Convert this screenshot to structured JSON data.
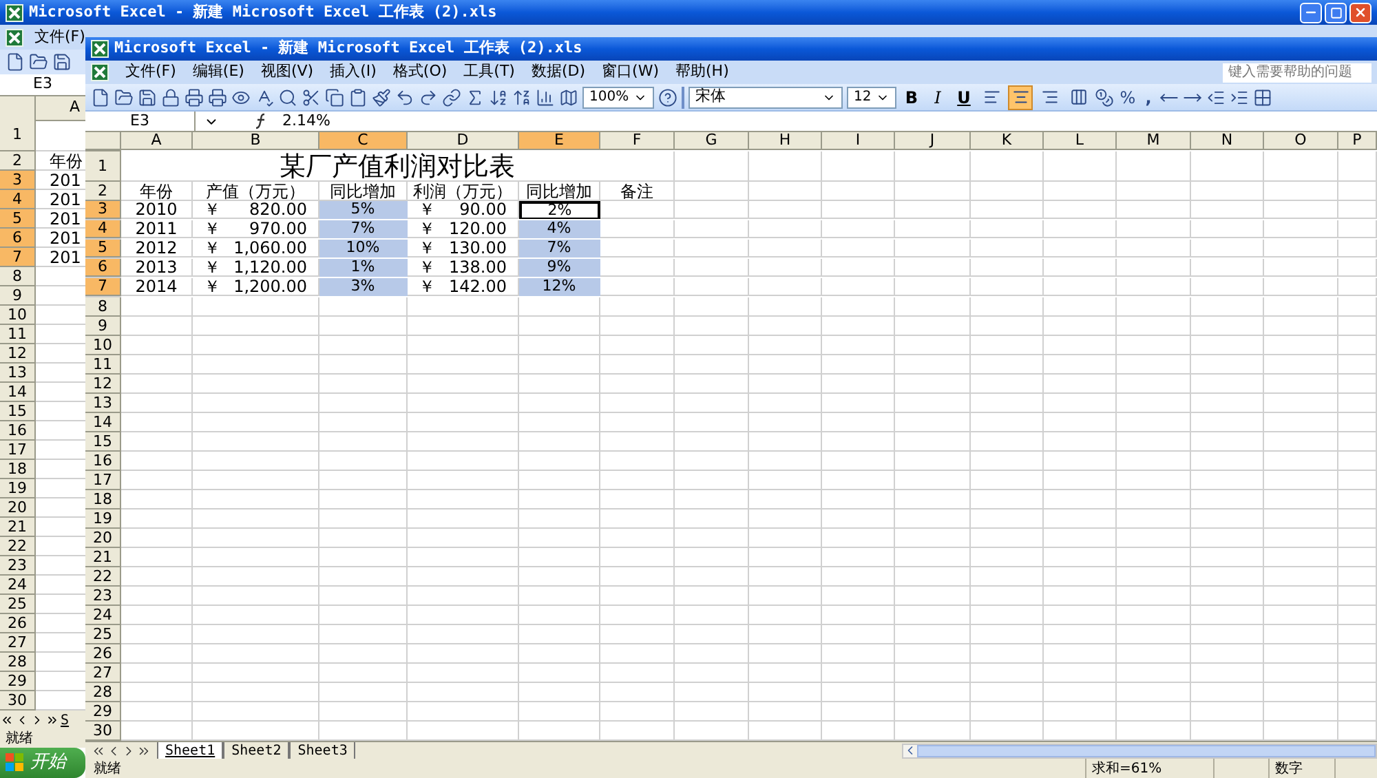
{
  "back_window": {
    "title": "Microsoft Excel - 新建 Microsoft Excel 工作表 (2).xls",
    "menu": [
      "文件(F)"
    ],
    "name_box": "E3",
    "column": {
      "label": "A",
      "selected": false
    },
    "rows": [
      {
        "label": "1",
        "selected": false
      },
      {
        "label": "2",
        "selected": false,
        "value": "年份"
      },
      {
        "label": "3",
        "selected": true,
        "value": "201"
      },
      {
        "label": "4",
        "selected": true,
        "value": "201"
      },
      {
        "label": "5",
        "selected": true,
        "value": "201"
      },
      {
        "label": "6",
        "selected": true,
        "value": "201"
      },
      {
        "label": "7",
        "selected": true,
        "value": "201"
      },
      {
        "label": "8",
        "selected": false
      },
      {
        "label": "9",
        "selected": false
      },
      {
        "label": "10",
        "selected": false
      },
      {
        "label": "11",
        "selected": false
      },
      {
        "label": "12",
        "selected": false
      },
      {
        "label": "13",
        "selected": false
      },
      {
        "label": "14",
        "selected": false
      },
      {
        "label": "15",
        "selected": false
      },
      {
        "label": "16",
        "selected": false
      },
      {
        "label": "17",
        "selected": false
      },
      {
        "label": "18",
        "selected": false
      },
      {
        "label": "19",
        "selected": false
      },
      {
        "label": "20",
        "selected": false
      },
      {
        "label": "21",
        "selected": false
      },
      {
        "label": "22",
        "selected": false
      },
      {
        "label": "23",
        "selected": false
      },
      {
        "label": "24",
        "selected": false
      },
      {
        "label": "25",
        "selected": false
      },
      {
        "label": "26",
        "selected": false
      },
      {
        "label": "27",
        "selected": false
      },
      {
        "label": "28",
        "selected": false
      },
      {
        "label": "29",
        "selected": false
      },
      {
        "label": "30",
        "selected": false
      }
    ],
    "sheet_tab": "S",
    "status": "就绪"
  },
  "taskbar": {
    "start": "开始"
  },
  "front_window": {
    "title": "Microsoft Excel - 新建 Microsoft Excel 工作表 (2).xls",
    "menu": [
      "文件(F)",
      "编辑(E)",
      "视图(V)",
      "插入(I)",
      "格式(O)",
      "工具(T)",
      "数据(D)",
      "窗口(W)",
      "帮助(H)"
    ],
    "help_box": {
      "placeholder": "键入需要帮助的问题"
    },
    "toolbar": {
      "zoom": "100%",
      "font": "宋体",
      "font_size": "12",
      "bold": "B",
      "italic": "I",
      "underline": "U",
      "alignment": [
        {
          "kind": "left",
          "selected": false
        },
        {
          "kind": "center",
          "selected": true
        },
        {
          "kind": "right",
          "selected": false
        },
        {
          "kind": "merge",
          "selected": false
        }
      ],
      "percent": "%",
      "comma": ","
    },
    "formula_bar": {
      "name_box": "E3",
      "value": "2.14%"
    },
    "columns": [
      {
        "label": "A",
        "selected": false
      },
      {
        "label": "B",
        "selected": false
      },
      {
        "label": "C",
        "selected": true
      },
      {
        "label": "D",
        "selected": false
      },
      {
        "label": "E",
        "selected": true
      },
      {
        "label": "F",
        "selected": false
      },
      {
        "label": "G",
        "selected": false
      },
      {
        "label": "H",
        "selected": false
      },
      {
        "label": "I",
        "selected": false
      },
      {
        "label": "J",
        "selected": false
      },
      {
        "label": "K",
        "selected": false
      },
      {
        "label": "L",
        "selected": false
      },
      {
        "label": "M",
        "selected": false
      },
      {
        "label": "N",
        "selected": false
      },
      {
        "label": "O",
        "selected": false
      },
      {
        "label": "P",
        "selected": false
      }
    ],
    "row_headers": [
      {
        "label": "1",
        "selected": false
      },
      {
        "label": "2",
        "selected": false
      },
      {
        "label": "3",
        "selected": true
      },
      {
        "label": "4",
        "selected": true
      },
      {
        "label": "5",
        "selected": true
      },
      {
        "label": "6",
        "selected": true
      },
      {
        "label": "7",
        "selected": true
      },
      {
        "label": "8",
        "selected": false
      },
      {
        "label": "9",
        "selected": false
      },
      {
        "label": "10",
        "selected": false
      },
      {
        "label": "11",
        "selected": false
      },
      {
        "label": "12",
        "selected": false
      },
      {
        "label": "13",
        "selected": false
      },
      {
        "label": "14",
        "selected": false
      },
      {
        "label": "15",
        "selected": false
      },
      {
        "label": "16",
        "selected": false
      },
      {
        "label": "17",
        "selected": false
      },
      {
        "label": "18",
        "selected": false
      },
      {
        "label": "19",
        "selected": false
      },
      {
        "label": "20",
        "selected": false
      },
      {
        "label": "21",
        "selected": false
      },
      {
        "label": "22",
        "selected": false
      },
      {
        "label": "23",
        "selected": false
      },
      {
        "label": "24",
        "selected": false
      },
      {
        "label": "25",
        "selected": false
      },
      {
        "label": "26",
        "selected": false
      },
      {
        "label": "27",
        "selected": false
      },
      {
        "label": "28",
        "selected": false
      },
      {
        "label": "29",
        "selected": false
      },
      {
        "label": "30",
        "selected": false
      }
    ],
    "table": {
      "title": "某厂产值利润对比表",
      "header": [
        "年份",
        "产值（万元）",
        "同比增加",
        "利润（万元）",
        "同比增加",
        "备注"
      ],
      "records": [
        {
          "year": "2010",
          "output": {
            "symbol": "￥",
            "amount": "820.00"
          },
          "output_growth": {
            "value": "5%",
            "selected": true,
            "active": false
          },
          "profit": {
            "symbol": "￥",
            "amount": "90.00"
          },
          "profit_growth": {
            "value": "2%",
            "selected": true,
            "active": true
          }
        },
        {
          "year": "2011",
          "output": {
            "symbol": "￥",
            "amount": "970.00"
          },
          "output_growth": {
            "value": "7%",
            "selected": true,
            "active": false
          },
          "profit": {
            "symbol": "￥",
            "amount": "120.00"
          },
          "profit_growth": {
            "value": "4%",
            "selected": true,
            "active": false
          }
        },
        {
          "year": "2012",
          "output": {
            "symbol": "￥",
            "amount": "1,060.00"
          },
          "output_growth": {
            "value": "10%",
            "selected": true,
            "active": false
          },
          "profit": {
            "symbol": "￥",
            "amount": "130.00"
          },
          "profit_growth": {
            "value": "7%",
            "selected": true,
            "active": false
          }
        },
        {
          "year": "2013",
          "output": {
            "symbol": "￥",
            "amount": "1,120.00"
          },
          "output_growth": {
            "value": "1%",
            "selected": true,
            "active": false
          },
          "profit": {
            "symbol": "￥",
            "amount": "138.00"
          },
          "profit_growth": {
            "value": "9%",
            "selected": true,
            "active": false
          }
        },
        {
          "year": "2014",
          "output": {
            "symbol": "￥",
            "amount": "1,200.00"
          },
          "output_growth": {
            "value": "3%",
            "selected": true,
            "active": false
          },
          "profit": {
            "symbol": "￥",
            "amount": "142.00"
          },
          "profit_growth": {
            "value": "12%",
            "selected": true,
            "active": false
          }
        }
      ]
    },
    "sheet_tabs": [
      {
        "label": "Sheet1",
        "selected": true
      },
      {
        "label": "Sheet2",
        "selected": false
      },
      {
        "label": "Sheet3",
        "selected": false
      }
    ],
    "status_bar": {
      "text": "就绪",
      "sum": "求和=61%",
      "mode": "数字"
    }
  }
}
